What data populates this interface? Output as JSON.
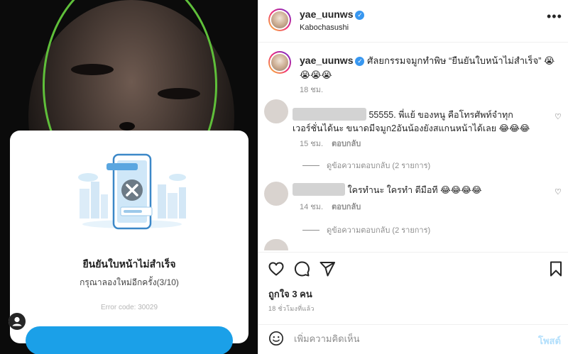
{
  "photo": {
    "card": {
      "title": "ยืนยันใบหน้าไม่สำเร็จ",
      "subtitle": "กรุณาลองใหม่อีกครั้ง(3/10)",
      "error_code": "Error code: 30029"
    }
  },
  "post": {
    "header": {
      "username": "yae_uunws",
      "location": "Kabochasushi",
      "more_icon": "more-horizontal-icon"
    },
    "caption": {
      "username": "yae_uunws",
      "text": "ศัลยกรรมจมูกทำพิษ “ยืนยันใบหน้าไม่สำเร็จ” 😭😭😭😭",
      "time": "18 ชม."
    },
    "comments": [
      {
        "text": "55555. พี่แย้ ของหนู คือโทรศัพท์จำทุกเวอร์ชั่นได้นะ ขนาดมีจมูก2อันน้องยังสแกนหน้าได้เลย 😂😂😂",
        "time": "15 ชม.",
        "reply_label": "ตอบกลับ",
        "view_replies": "ดูข้อความตอบกลับ (2 รายการ)"
      },
      {
        "text": "ใครทำนะ ใครทำ ตีมือที 😂😂😂😂",
        "time": "14 ชม.",
        "reply_label": "ตอบกลับ",
        "view_replies": "ดูข้อความตอบกลับ (2 รายการ)"
      }
    ],
    "likes": "ถูกใจ 3 คน",
    "timestamp": "18 ชั่วโมงที่แล้ว",
    "add_comment": {
      "placeholder": "เพิ่มความคิดเห็น",
      "post_label": "โพสต์"
    }
  },
  "colors": {
    "accent": "#3897f0",
    "ring": "#5fbf3a",
    "card_button": "#1ba0e8",
    "post_disabled": "#b2dffc"
  }
}
